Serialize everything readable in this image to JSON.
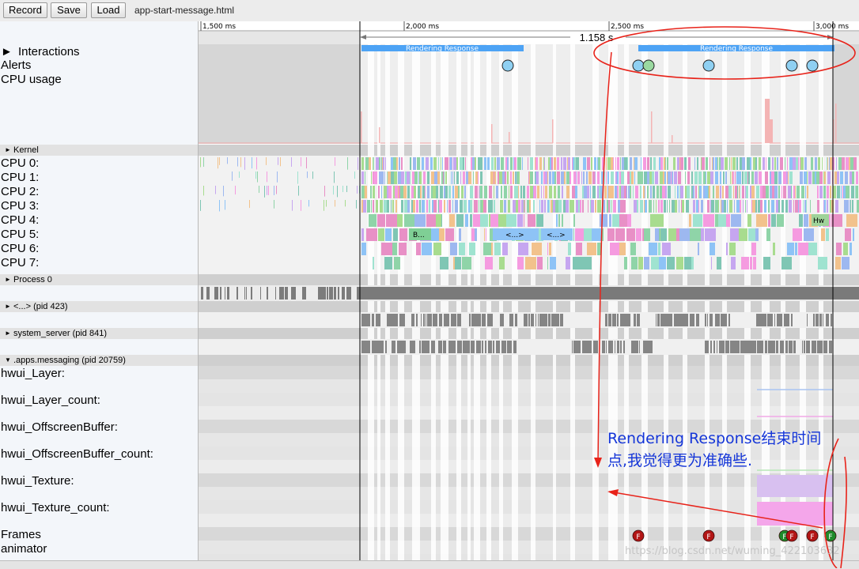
{
  "toolbar": {
    "record_label": "Record",
    "save_label": "Save",
    "load_label": "Load",
    "filename": "app-start-message.html"
  },
  "ruler": {
    "ticks": [
      "1,500 ms",
      "2,000 ms",
      "2,500 ms",
      "3,000 ms"
    ],
    "selection_duration": "1.158 s"
  },
  "interactions": {
    "label": "Interactions",
    "slices": [
      "Rendering Response",
      "Rendering Response"
    ]
  },
  "alerts": {
    "label": "Alerts"
  },
  "cpu_usage": {
    "label": "CPU usage"
  },
  "kernel": {
    "title": "Kernel",
    "cpus": [
      "CPU 0:",
      "CPU 1:",
      "CPU 2:",
      "CPU 3:",
      "CPU 4:",
      "CPU 5:",
      "CPU 6:",
      "CPU 7:"
    ],
    "slice_labels": [
      "B...",
      "<...>",
      "<...>",
      "Hw"
    ]
  },
  "process0": {
    "title": "Process 0"
  },
  "process423": {
    "title": "<...> (pid 423)"
  },
  "system_server": {
    "title": "system_server (pid 841)"
  },
  "messaging": {
    "title": ".apps.messaging (pid 20759)",
    "counters": [
      "hwui_Layer:",
      "hwui_Layer_count:",
      "hwui_OffscreenBuffer:",
      "hwui_OffscreenBuffer_count:",
      "hwui_Texture:",
      "hwui_Texture_count:"
    ],
    "frames_label": "Frames",
    "animator_label": "animator",
    "frame_marker": "F"
  },
  "annotation": {
    "line1": "Rendering Response结束时间",
    "line2": "点,我觉得更为准确些."
  },
  "watermark": "https://blog.csdn.net/wuming_422103632",
  "colors": {
    "rendering_response": "#4da3f5",
    "annotation_red": "#e8231a",
    "annotation_text": "#1536d8",
    "frame_red": "#b31616",
    "frame_green": "#1e8a2a"
  }
}
